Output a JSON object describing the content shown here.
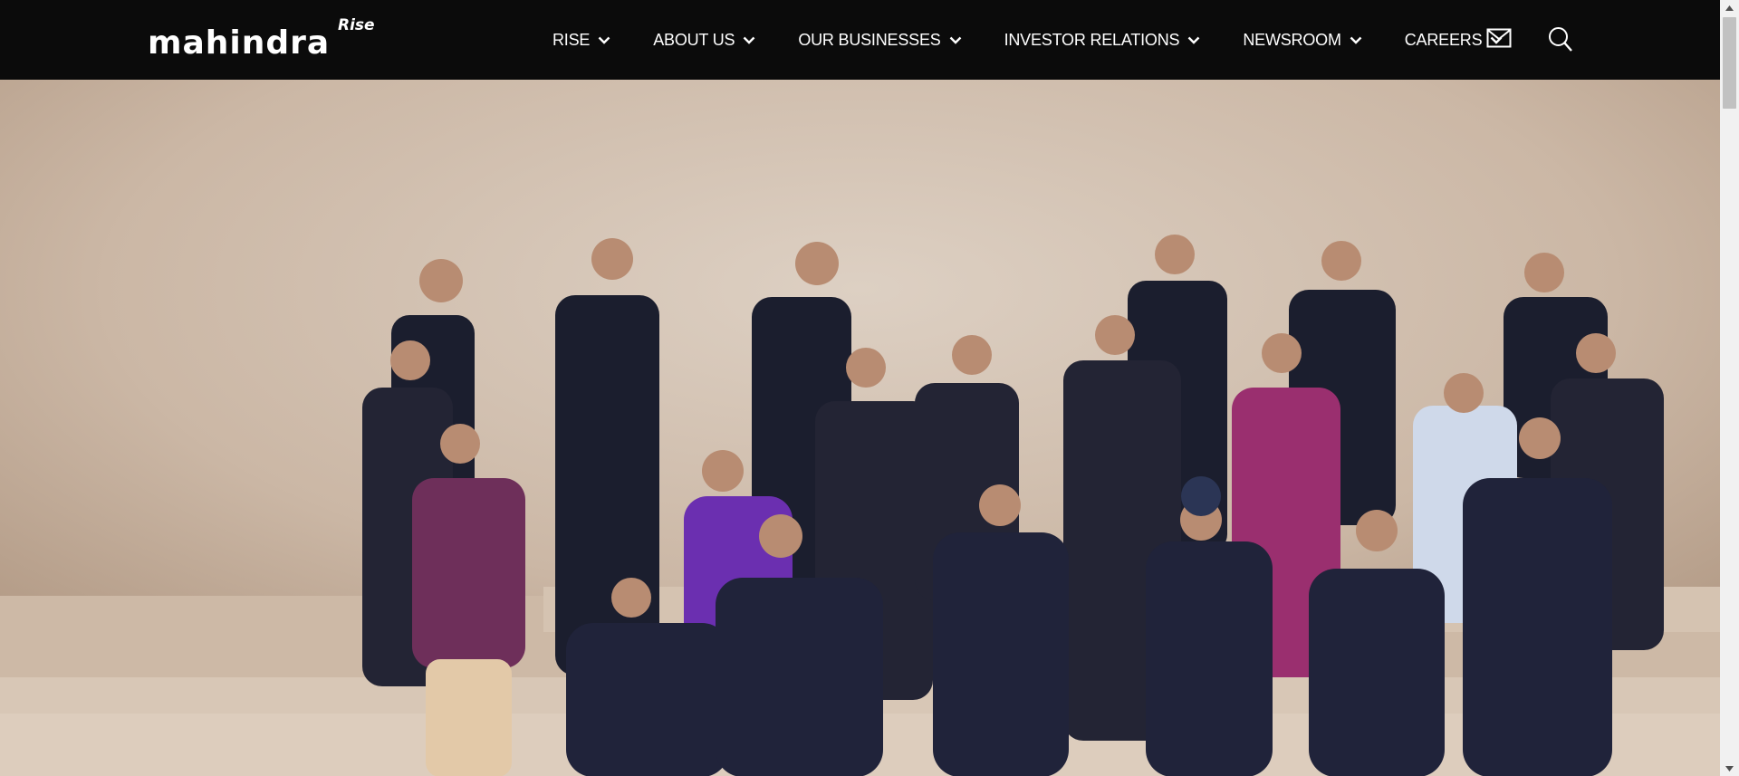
{
  "brand": {
    "name": "mahindra",
    "tagline": "Rise"
  },
  "nav": {
    "items": [
      {
        "label": "RISE"
      },
      {
        "label": "ABOUT US"
      },
      {
        "label": "OUR BUSINESSES"
      },
      {
        "label": "INVESTOR RELATIONS"
      },
      {
        "label": "NEWSROOM"
      },
      {
        "label": "CAREERS"
      }
    ],
    "icons": {
      "mail": "mail-icon",
      "search": "search-icon",
      "chevron": "chevron-down-icon"
    }
  },
  "hero": {
    "image": "group photo of company leadership team posing on wooden stools and stepped platforms against a beige backdrop"
  },
  "colors": {
    "header_bg": "#0b0b0b",
    "nav_text": "#ffffff",
    "backdrop": "#c9b5a3"
  }
}
